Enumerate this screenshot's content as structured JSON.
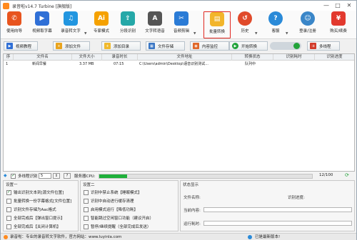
{
  "window": {
    "title": "录音啦v14.7 Turbine [旗舰版]",
    "minimize": "—",
    "maximize": "□",
    "close": "✕"
  },
  "toolbar": [
    {
      "label": "使用向导",
      "icon": "megaphone-icon",
      "color": "#e8541e",
      "glyph": "📢"
    },
    {
      "label": "视频取字幕",
      "icon": "video-icon",
      "color": "#2f6fd6",
      "glyph": "▶"
    },
    {
      "label": "录音转文字",
      "icon": "mic-icon",
      "color": "#2296e0",
      "glyph": "🎙"
    },
    {
      "label": "专家模式",
      "icon": "ai-icon",
      "color": "#f5a100",
      "glyph": "Ai"
    },
    {
      "label": "分段识别",
      "icon": "upload-icon",
      "color": "#25a8a8",
      "glyph": "⇪"
    },
    {
      "label": "文字转语音",
      "icon": "text-speech-icon",
      "color": "#555555",
      "glyph": "A"
    },
    {
      "label": "音频剪辑",
      "icon": "scissors-icon",
      "color": "#2a7bd6",
      "glyph": "✂"
    },
    {
      "label": "批量转换",
      "icon": "folder-icon",
      "color": "#f2b52b",
      "glyph": "▤"
    },
    {
      "label": "历史",
      "icon": "history-icon",
      "color": "#e04a2a",
      "glyph": "↺"
    },
    {
      "label": "客服",
      "icon": "help-icon",
      "color": "#2a8ad8",
      "glyph": "?"
    },
    {
      "label": "登录/注册",
      "icon": "user-icon",
      "color": "#3a86c8",
      "glyph": "☺"
    },
    {
      "label": "购买/续费",
      "icon": "cart-icon",
      "color": "#e2392e",
      "glyph": "¥"
    }
  ],
  "toolbar2": {
    "tutorial": "视频教程",
    "add_file": "添加文件",
    "add_dir": "添加目录",
    "file_storage": "文件存储",
    "content_monitor": "内容监控",
    "start": "开始转换",
    "multithread": "多线程"
  },
  "table": {
    "headers": [
      "序",
      "文件名",
      "文件大小",
      "录音时长",
      "文件地址",
      "转换状态",
      "识别耗时",
      "识别进度"
    ],
    "rows": [
      [
        "1",
        "新闻早餐",
        "3.37 MB",
        "07:15",
        "C:\\Users\\admin\\Desktop\\语音识别测试...",
        "队列中",
        "",
        ""
      ]
    ]
  },
  "progress_row": {
    "multithread_label": "多线程识别",
    "threads": "5",
    "server_cpu": "服务器CPU:",
    "progress": 0.13,
    "count": "12/100",
    "arrow_question": "?"
  },
  "settings1": {
    "title": "设置一",
    "options": [
      {
        "label": "输出识别文本到[源文件位置]",
        "checked": true
      },
      {
        "label": "批量转换一份字幕格式[文件位置]",
        "checked": false
      },
      {
        "label": "识别文件存储为Aac格式",
        "checked": false
      },
      {
        "label": "全部完成后【弹出窗口提示】",
        "checked": false
      },
      {
        "label": "全部完成后【关闭计算机】",
        "checked": false
      }
    ]
  },
  "settings2": {
    "title": "设置二",
    "options": [
      {
        "label": "识别中禁止系统【睡眠模式】",
        "checked": false
      },
      {
        "label": "识别中自动进行缓存清理",
        "checked": false
      },
      {
        "label": "启用模式运行【降低功耗】",
        "checked": false
      },
      {
        "label": "智能跳过空闲窗口功能（建议开启）",
        "checked": false
      },
      {
        "label": "暂停/继续提醒（全部完成后发送）",
        "checked": false
      }
    ]
  },
  "status": {
    "title": "状态显示",
    "filename_label": "文件名称:",
    "progress_label": "识别进度:",
    "current_label": "当前内容:",
    "elapsed_label": "运行耗时:"
  },
  "statusbar": {
    "left": "录音啦：专业的录音转文字软件，官方网站：www.luyinla.com",
    "right": "已是最新版本!"
  }
}
